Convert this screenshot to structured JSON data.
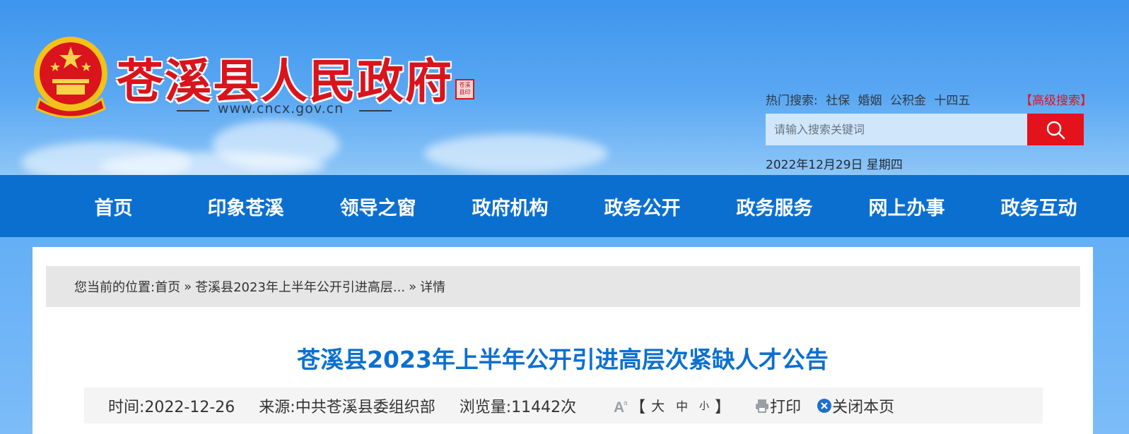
{
  "header": {
    "site_title": "苍溪县人民政府",
    "url": "www.cncx.gov.cn",
    "seal_text": "苍溪县印",
    "hot_label": "热门搜索:",
    "hot_terms": [
      "社保",
      "婚姻",
      "公积金",
      "十四五"
    ],
    "advanced_search": "【高级搜索】",
    "search_placeholder": "请输入搜索关键词",
    "date": "2022年12月29日 星期四"
  },
  "nav": {
    "items": [
      "首页",
      "印象苍溪",
      "领导之窗",
      "政府机构",
      "政务公开",
      "政务服务",
      "网上办事",
      "政务互动"
    ]
  },
  "breadcrumb": {
    "prefix": "您当前的位置:",
    "home": "首页",
    "sep": "»",
    "parent": "苍溪县2023年上半年公开引进高层...",
    "current": "详情"
  },
  "article": {
    "title": "苍溪县2023年上半年公开引进高层次紧缺人才公告",
    "time": "时间:2022-12-26",
    "source": "来源:中共苍溪县委组织部",
    "views": "浏览量:11442次",
    "font_open": "【",
    "font_large": "大",
    "font_medium": "中",
    "font_small": "小",
    "font_close": "】",
    "print": "打印",
    "close": "关闭本页"
  },
  "colors": {
    "brand_blue": "#0b6fd0",
    "accent_red": "#e3121b"
  }
}
